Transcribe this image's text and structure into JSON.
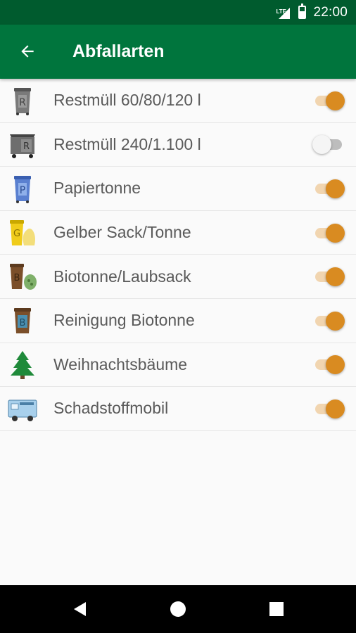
{
  "status_bar": {
    "network": "LTE",
    "time": "22:00",
    "signal_icon": "signal-icon",
    "battery_icon": "battery-icon",
    "background": "#005b2e"
  },
  "app_bar": {
    "title": "Abfallarten",
    "back_icon": "arrow-back-icon",
    "background": "#00753d"
  },
  "items": [
    {
      "label": "Restmüll 60/80/120 l",
      "icon": "grey-bin-r-icon",
      "enabled": true
    },
    {
      "label": "Restmüll 240/1.100 l",
      "icon": "large-grey-container-r-icon",
      "enabled": false
    },
    {
      "label": "Papiertonne",
      "icon": "blue-bin-p-icon",
      "enabled": true
    },
    {
      "label": "Gelber Sack/Tonne",
      "icon": "yellow-bin-sack-g-icon",
      "enabled": true
    },
    {
      "label": "Biotonne/Laubsack",
      "icon": "brown-bin-b-sack-icon",
      "enabled": true
    },
    {
      "label": "Reinigung Biotonne",
      "icon": "brown-bin-b-clean-icon",
      "enabled": true
    },
    {
      "label": "Weihnachtsbäume",
      "icon": "christmas-tree-icon",
      "enabled": true
    },
    {
      "label": "Schadstoffmobil",
      "icon": "hazardous-waste-truck-icon",
      "enabled": true
    }
  ],
  "toggle_colors": {
    "on_thumb": "#d98b21",
    "on_track": "#f1d5b0",
    "off_thumb": "#f5f5f5",
    "off_track": "#bdbdbd"
  },
  "nav_bar": {
    "back": "nav-back-icon",
    "home": "nav-home-icon",
    "recents": "nav-recents-icon"
  }
}
